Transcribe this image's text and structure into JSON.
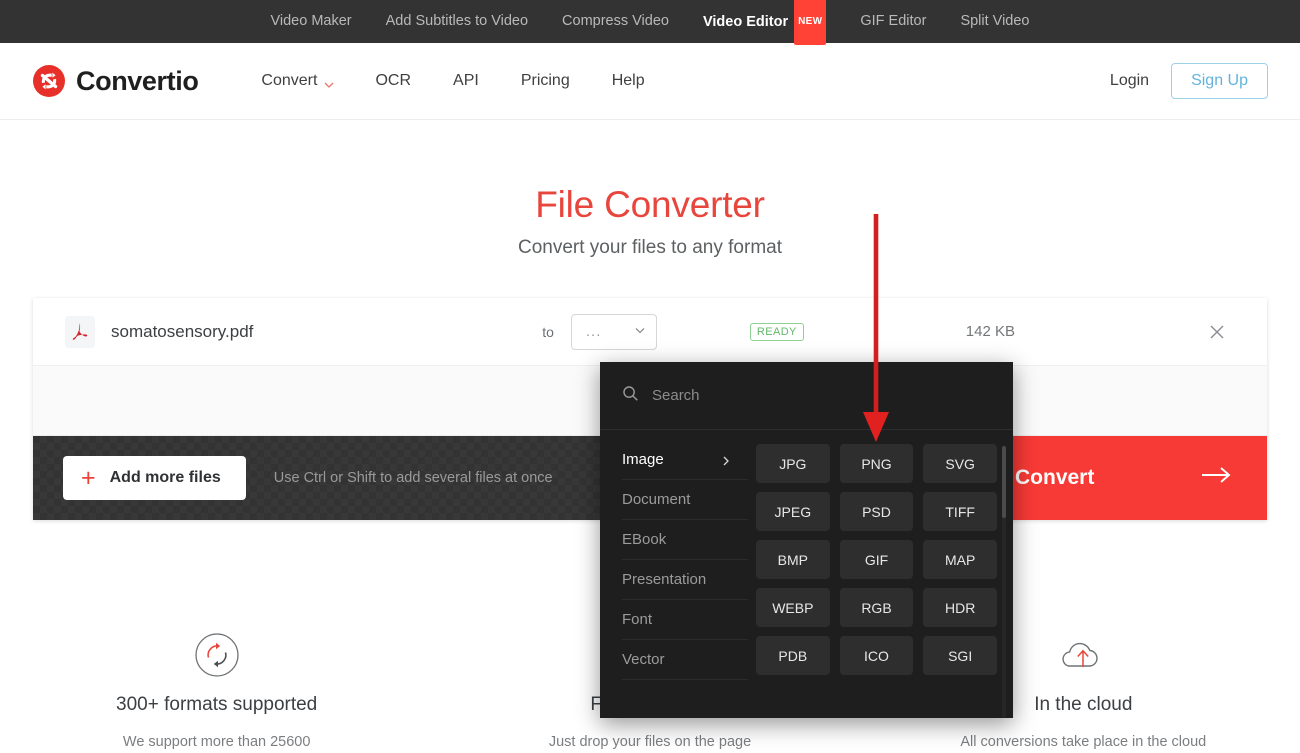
{
  "topbar": {
    "items": [
      {
        "label": "Video Maker",
        "active": false,
        "badge": ""
      },
      {
        "label": "Add Subtitles to Video",
        "active": false,
        "badge": ""
      },
      {
        "label": "Compress Video",
        "active": false,
        "badge": ""
      },
      {
        "label": "Video Editor",
        "active": true,
        "badge": "NEW"
      },
      {
        "label": "GIF Editor",
        "active": false,
        "badge": ""
      },
      {
        "label": "Split Video",
        "active": false,
        "badge": ""
      }
    ]
  },
  "header": {
    "brand": "Convertio",
    "logo_icon": "convertio-circle-arrows-logo",
    "nav": [
      {
        "label": "Convert",
        "icon": "chevron-down-icon"
      },
      {
        "label": "OCR",
        "icon": ""
      },
      {
        "label": "API",
        "icon": ""
      },
      {
        "label": "Pricing",
        "icon": ""
      },
      {
        "label": "Help",
        "icon": ""
      }
    ],
    "login_label": "Login",
    "signup_label": "Sign Up",
    "accent_color": "#e8463d",
    "signup_color": "#63b3dd"
  },
  "hero": {
    "title": "File Converter",
    "subtitle": "Convert your files to any format"
  },
  "converter": {
    "file": {
      "icon": "pdf-file-icon",
      "name": "somatosensory.pdf",
      "to_label": "to",
      "target_format": "...",
      "target_format_icon": "chevron-down-icon",
      "status": "READY",
      "status_color": "#63b96c",
      "size": "142 KB",
      "remove_icon": "close-icon"
    },
    "add_more_label": "Add more files",
    "add_more_icon": "plus-icon",
    "hint": "Use Ctrl or Shift to add several files at once",
    "convert_label": "Convert",
    "convert_icon": "arrow-right-icon",
    "convert_color": "#f83a36"
  },
  "format_panel": {
    "search_placeholder": "Search",
    "search_value": "",
    "search_icon": "search-icon",
    "categories": [
      {
        "label": "Image",
        "active": true,
        "icon": "chevron-right-icon"
      },
      {
        "label": "Document",
        "active": false,
        "icon": ""
      },
      {
        "label": "EBook",
        "active": false,
        "icon": ""
      },
      {
        "label": "Presentation",
        "active": false,
        "icon": ""
      },
      {
        "label": "Font",
        "active": false,
        "icon": ""
      },
      {
        "label": "Vector",
        "active": false,
        "icon": ""
      }
    ],
    "formats": [
      "JPG",
      "PNG",
      "SVG",
      "JPEG",
      "PSD",
      "TIFF",
      "BMP",
      "GIF",
      "MAP",
      "WEBP",
      "RGB",
      "HDR",
      "PDB",
      "ICO",
      "SGI"
    ]
  },
  "annotation": {
    "icon": "red-down-arrow-annotation",
    "color": "#e02020",
    "points_to": "PNG"
  },
  "features": [
    {
      "icon": "refresh-circle-icon",
      "title": "300+ formats supported",
      "text": "We support more than 25600"
    },
    {
      "icon": "cursor-click-icon",
      "title": "Fast and easy",
      "text": "Just drop your files on the page"
    },
    {
      "icon": "cloud-upload-icon",
      "title": "In the cloud",
      "text": "All conversions take place in the cloud"
    }
  ]
}
